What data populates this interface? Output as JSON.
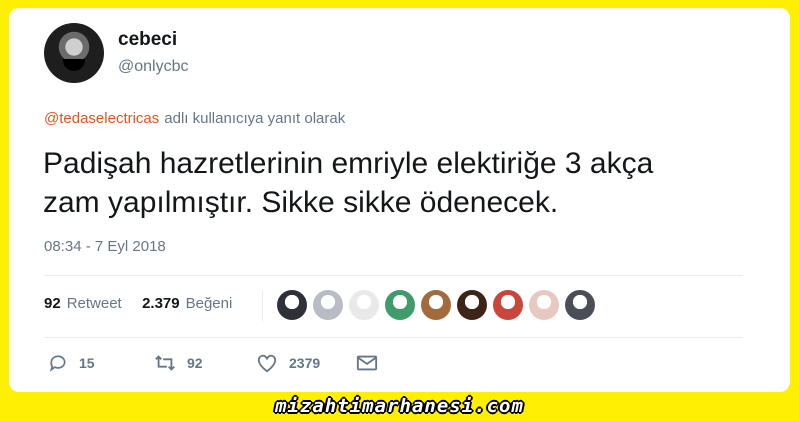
{
  "tweet": {
    "display_name": "cebeci",
    "handle": "@onlycbc",
    "reply_to_mention": "@tedaselectricas",
    "reply_to_text": "adlı kullanıcıya yanıt olarak",
    "text_line1": "Padişah hazretlerinin emriyle elektiriğe 3 akça",
    "text_line2": "zam yapılmıştır. Sikke sikke ödenecek.",
    "timestamp": "08:34 - 7 Eyl 2018"
  },
  "stats": {
    "retweet_count": "92",
    "retweet_label": "Retweet",
    "like_count": "2.379",
    "like_label": "Beğeni"
  },
  "likers": [
    {
      "color": "#2e3138"
    },
    {
      "color": "#b8bcc4"
    },
    {
      "color": "#e9e9e9"
    },
    {
      "color": "#3f9b6a"
    },
    {
      "color": "#a36a3c"
    },
    {
      "color": "#3c2418"
    },
    {
      "color": "#c9463b"
    },
    {
      "color": "#e8c9bf"
    },
    {
      "color": "#4a4f57"
    }
  ],
  "actions": {
    "reply_count": "15",
    "retweet_count": "92",
    "like_count": "2379"
  },
  "watermark": "mizahtimarhanesi.com",
  "colors": {
    "background": "#ffef00",
    "mention": "#e0561f",
    "secondary_text": "#657786"
  }
}
